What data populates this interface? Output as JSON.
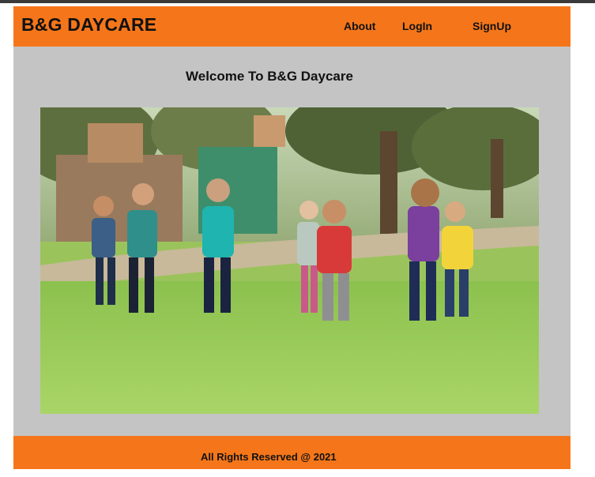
{
  "header": {
    "brand": "B&G DAYCARE",
    "nav": {
      "about": "About",
      "login": "LogIn",
      "signup": "SignUp"
    }
  },
  "main": {
    "welcome": "Welcome To B&G Daycare",
    "hero_image": {
      "icon": "children-running-in-park-photo"
    }
  },
  "footer": {
    "text": "All Rights Reserved @ 2021"
  },
  "colors": {
    "accent": "#f5761a",
    "page_bg": "#c4c4c4",
    "text": "#111111"
  }
}
